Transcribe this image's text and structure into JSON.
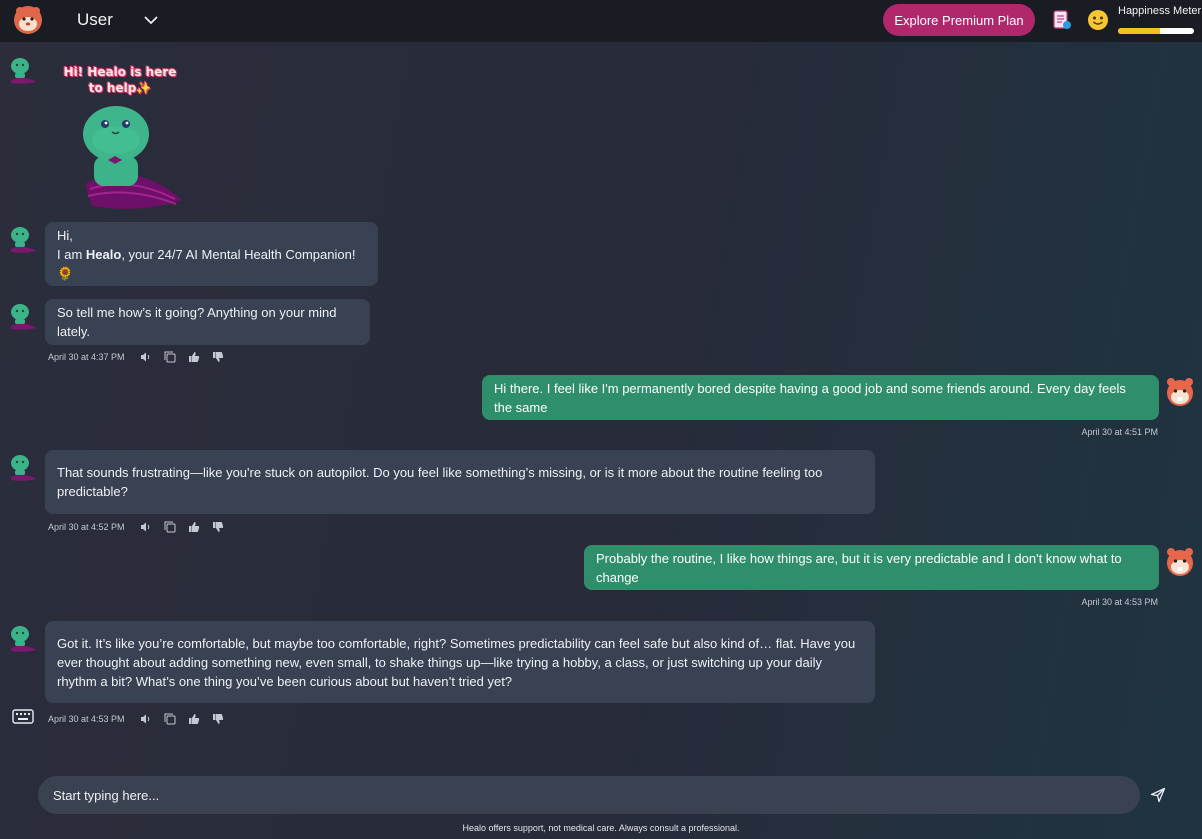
{
  "header": {
    "user_label": "User",
    "premium_button": "Explore Premium Plan",
    "happiness_meter_label": "Happiness Meter",
    "happiness_level_percent": 55,
    "accent_color": "#b0276b",
    "meter_fill_color": "#f4c21f"
  },
  "welcome_sticker": {
    "line1": "Hi! Healo is here",
    "line2": "to help✨"
  },
  "messages": [
    {
      "from": "bot",
      "line1": "Hi,",
      "prefix": "I am ",
      "name": "Healo",
      "suffix": ", your 24/7 AI Mental Health Companion! 🌻"
    },
    {
      "from": "bot",
      "text": "So tell me how’s it going? Anything on your mind lately.",
      "time": "April 30 at 4:37 PM"
    },
    {
      "from": "user",
      "text": "Hi there. I feel like I'm permanently bored despite having a good job and some friends around. Every day feels the same",
      "time": "April 30 at 4:51 PM"
    },
    {
      "from": "bot",
      "text": "That sounds frustrating—like you're stuck on autopilot. Do you feel like something’s missing, or is it more about the routine feeling too predictable?",
      "time": "April 30 at 4:52 PM"
    },
    {
      "from": "user",
      "text": "Probably the routine, I like how things are, but it is very predictable and I don't know what to change",
      "time": "April 30 at 4:53 PM"
    },
    {
      "from": "bot",
      "text": "Got it. It’s like you’re comfortable, but maybe too comfortable, right? Sometimes predictability can feel safe but also kind of… flat. Have you ever thought about adding something new, even small, to shake things up—like trying a hobby, a class, or just switching up your daily rhythm a bit? What’s one thing you’ve been curious about but haven’t tried yet?",
      "time": "April 30 at 4:53 PM"
    }
  ],
  "input": {
    "placeholder": "Start typing here..."
  },
  "footer": {
    "disclaimer": "Healo offers support, not medical care. Always consult a professional."
  },
  "icons": [
    "healo-logo-icon",
    "chevron-down-icon",
    "notes-icon",
    "smile-icon",
    "healo-avatar-icon",
    "user-avatar-icon",
    "speaker-icon",
    "copy-icon",
    "thumbs-up-icon",
    "thumbs-down-icon",
    "keyboard-icon",
    "send-icon"
  ]
}
